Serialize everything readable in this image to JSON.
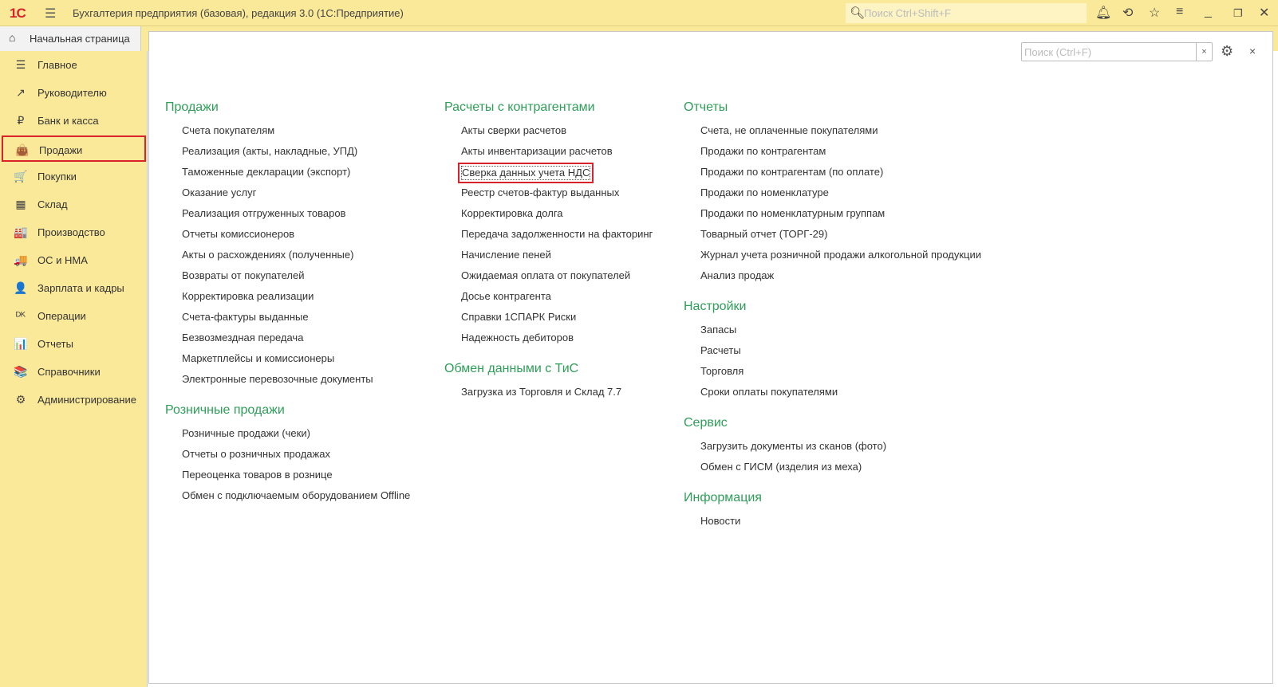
{
  "titlebar": {
    "logo": "1С",
    "title": "Бухгалтерия предприятия (базовая), редакция 3.0  (1С:Предприятие)",
    "search_placeholder": "Поиск Ctrl+Shift+F"
  },
  "home_tab": "Начальная страница",
  "sidebar": [
    {
      "label": "Главное",
      "icon": "☰"
    },
    {
      "label": "Руководителю",
      "icon": "↗"
    },
    {
      "label": "Банк и касса",
      "icon": "₽"
    },
    {
      "label": "Продажи",
      "icon": "👜",
      "active": true
    },
    {
      "label": "Покупки",
      "icon": "🛒"
    },
    {
      "label": "Склад",
      "icon": "▦"
    },
    {
      "label": "Производство",
      "icon": "🏭"
    },
    {
      "label": "ОС и НМА",
      "icon": "🚚"
    },
    {
      "label": "Зарплата и кадры",
      "icon": "👤"
    },
    {
      "label": "Операции",
      "icon": "ᴰᴷ"
    },
    {
      "label": "Отчеты",
      "icon": "📊"
    },
    {
      "label": "Справочники",
      "icon": "📚"
    },
    {
      "label": "Администрирование",
      "icon": "⚙"
    }
  ],
  "form": {
    "search_placeholder": "Поиск (Ctrl+F)",
    "clear": "×",
    "close": "×"
  },
  "columns": [
    [
      {
        "title": "Продажи",
        "items": [
          "Счета покупателям",
          "Реализация (акты, накладные, УПД)",
          "Таможенные декларации (экспорт)",
          "Оказание услуг",
          "Реализация отгруженных товаров",
          "Отчеты комиссионеров",
          "Акты о расхождениях (полученные)",
          "Возвраты от покупателей",
          "Корректировка реализации",
          "Счета-фактуры выданные",
          "Безвозмездная передача",
          "Маркетплейсы и комиссионеры",
          "Электронные перевозочные документы"
        ]
      },
      {
        "title": "Розничные продажи",
        "items": [
          "Розничные продажи (чеки)",
          "Отчеты о розничных продажах",
          "Переоценка товаров в рознице",
          "Обмен с подключаемым оборудованием Offline"
        ]
      }
    ],
    [
      {
        "title": "Расчеты с контрагентами",
        "items": [
          "Акты сверки расчетов",
          "Акты инвентаризации расчетов",
          "Сверка данных учета НДС",
          "Реестр счетов-фактур выданных",
          "Корректировка долга",
          "Передача задолженности на факторинг",
          "Начисление пеней",
          "Ожидаемая оплата от покупателей",
          "Досье контрагента",
          "Справки 1СПАРК Риски",
          "Надежность дебиторов"
        ]
      },
      {
        "title": "Обмен данными с ТиС",
        "items": [
          "Загрузка из Торговля и Склад 7.7"
        ]
      }
    ],
    [
      {
        "title": "Отчеты",
        "items": [
          "Счета, не оплаченные покупателями",
          "Продажи по контрагентам",
          "Продажи по контрагентам (по оплате)",
          "Продажи по номенклатуре",
          "Продажи по номенклатурным группам",
          "Товарный отчет (ТОРГ-29)",
          "Журнал учета розничной продажи алкогольной продукции",
          "Анализ продаж"
        ]
      },
      {
        "title": "Настройки",
        "items": [
          "Запасы",
          "Расчеты",
          "Торговля",
          "Сроки оплаты покупателями"
        ]
      },
      {
        "title": "Сервис",
        "items": [
          "Загрузить документы из сканов (фото)",
          "Обмен с ГИСМ (изделия из меха)"
        ]
      },
      {
        "title": "Информация",
        "items": [
          "Новости"
        ]
      }
    ]
  ],
  "highlighted": "Сверка данных учета НДС"
}
